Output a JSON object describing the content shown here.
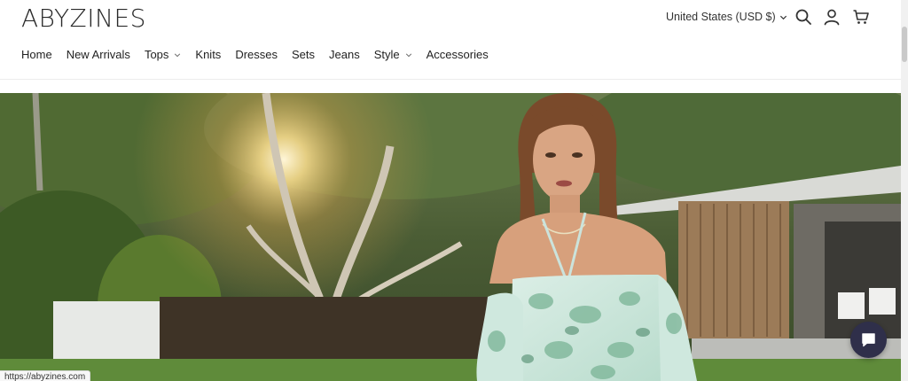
{
  "header": {
    "logo": "ABYZINES",
    "currency": "United States (USD $)",
    "icons": [
      "search-icon",
      "account-icon",
      "cart-icon"
    ]
  },
  "nav": {
    "items": [
      {
        "label": "Home",
        "has_dropdown": false
      },
      {
        "label": "New Arrivals",
        "has_dropdown": false
      },
      {
        "label": "Tops",
        "has_dropdown": true
      },
      {
        "label": "Knits",
        "has_dropdown": false
      },
      {
        "label": "Dresses",
        "has_dropdown": false
      },
      {
        "label": "Sets",
        "has_dropdown": false
      },
      {
        "label": "Jeans",
        "has_dropdown": false
      },
      {
        "label": "Style",
        "has_dropdown": true
      },
      {
        "label": "Accessories",
        "has_dropdown": false
      }
    ]
  },
  "status_bar": {
    "url": "https://abyzines.com"
  },
  "colors": {
    "chat_button": "#2f2f4a",
    "text": "#222222"
  }
}
